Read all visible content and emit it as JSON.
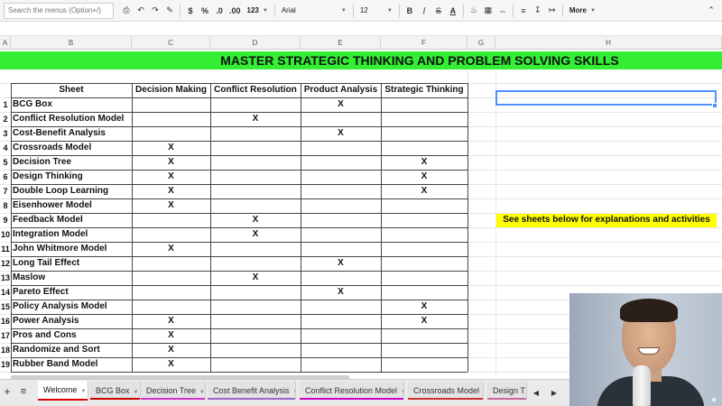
{
  "toolbar": {
    "search_placeholder": "Search the menus (Option+/)",
    "currency": "$",
    "percent": "%",
    "dec_decrease": ".0",
    "dec_increase": ".00",
    "number_format": "123",
    "font_name": "Arial",
    "font_size": "12",
    "bold": "B",
    "italic": "I",
    "strike": "S",
    "text_color": "A",
    "more": "More"
  },
  "columns": [
    "A",
    "B",
    "C",
    "D",
    "E",
    "F",
    "G",
    "H"
  ],
  "sheet": {
    "title": "MASTER STRATEGIC THINKING AND PROBLEM SOLVING SKILLS",
    "header": [
      "Sheet",
      "Decision Making",
      "Conflict Resolution",
      "Product Analysis",
      "Strategic Thinking"
    ],
    "rows": [
      {
        "num": "1",
        "name": "BCG Box",
        "marks": [
          "",
          "",
          "X",
          ""
        ]
      },
      {
        "num": "2",
        "name": "Conflict Resolution Model",
        "marks": [
          "",
          "X",
          "",
          ""
        ]
      },
      {
        "num": "3",
        "name": "Cost-Benefit Analysis",
        "marks": [
          "",
          "",
          "X",
          ""
        ]
      },
      {
        "num": "4",
        "name": "Crossroads Model",
        "marks": [
          "X",
          "",
          "",
          ""
        ]
      },
      {
        "num": "5",
        "name": "Decision Tree",
        "marks": [
          "X",
          "",
          "",
          "X"
        ]
      },
      {
        "num": "6",
        "name": "Design Thinking",
        "marks": [
          "X",
          "",
          "",
          "X"
        ]
      },
      {
        "num": "7",
        "name": "Double Loop Learning",
        "marks": [
          "X",
          "",
          "",
          "X"
        ]
      },
      {
        "num": "8",
        "name": "Eisenhower Model",
        "marks": [
          "X",
          "",
          "",
          ""
        ]
      },
      {
        "num": "9",
        "name": "Feedback Model",
        "marks": [
          "",
          "X",
          "",
          ""
        ]
      },
      {
        "num": "10",
        "name": "Integration Model",
        "marks": [
          "",
          "X",
          "",
          ""
        ]
      },
      {
        "num": "11",
        "name": "John Whitmore Model",
        "marks": [
          "X",
          "",
          "",
          ""
        ]
      },
      {
        "num": "12",
        "name": "Long Tail Effect",
        "marks": [
          "",
          "",
          "X",
          ""
        ]
      },
      {
        "num": "13",
        "name": "Maslow",
        "marks": [
          "",
          "X",
          "",
          ""
        ]
      },
      {
        "num": "14",
        "name": "Pareto Effect",
        "marks": [
          "",
          "",
          "X",
          ""
        ]
      },
      {
        "num": "15",
        "name": "Policy Analysis Model",
        "marks": [
          "",
          "",
          "",
          "X"
        ]
      },
      {
        "num": "16",
        "name": "Power Analysis",
        "marks": [
          "X",
          "",
          "",
          "X"
        ]
      },
      {
        "num": "17",
        "name": "Pros and Cons",
        "marks": [
          "X",
          "",
          "",
          ""
        ]
      },
      {
        "num": "18",
        "name": "Randomize and Sort",
        "marks": [
          "X",
          "",
          "",
          ""
        ]
      },
      {
        "num": "19",
        "name": "Rubber Band Model",
        "marks": [
          "X",
          "",
          "",
          ""
        ]
      }
    ],
    "note": "See sheets below for explanations and activities"
  },
  "tabs": [
    {
      "label": "Welcome",
      "color": "#e00000",
      "active": true
    },
    {
      "label": "BCG Box",
      "color": "#cc0000"
    },
    {
      "label": "Decision Tree",
      "color": "#cc33cc"
    },
    {
      "label": "Cost Benefit Analysis",
      "color": "#9966cc"
    },
    {
      "label": "Conflict Resolution Model",
      "color": "#cc00cc"
    },
    {
      "label": "Crossroads Model",
      "color": "#cc3333"
    },
    {
      "label": "Design T",
      "color": "#cc6699"
    }
  ],
  "colors": {
    "title_band": "#33ee33",
    "note_highlight": "#ffff00",
    "selection": "#4d90fe"
  }
}
